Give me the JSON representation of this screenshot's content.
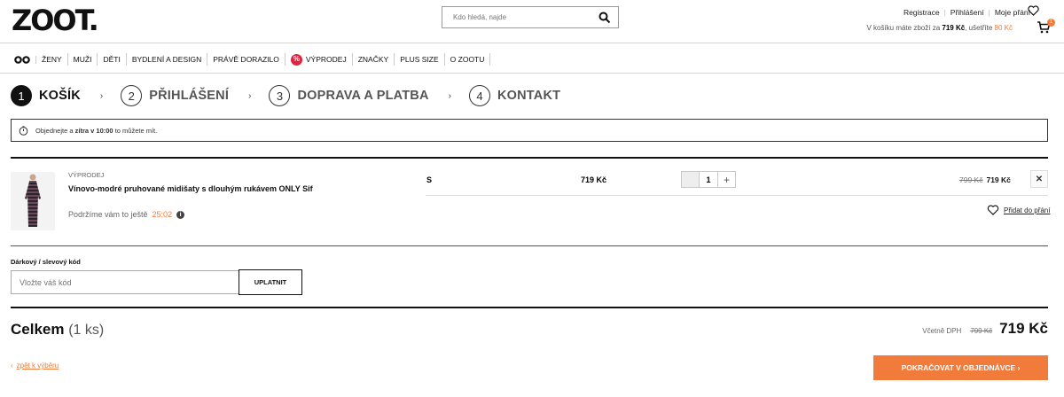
{
  "header": {
    "logo": "ZOOT.",
    "search_placeholder": "Kdo hledá, najde",
    "links": [
      "Registrace",
      "Přihlášení",
      "Moje přání"
    ],
    "cart_info_prefix": "V košíku máte zboží za",
    "cart_total": "719 Kč",
    "cart_info_mid": ", ušetříte",
    "cart_savings": "80 Kč",
    "cart_count": "1"
  },
  "nav": {
    "items": [
      "ŽENY",
      "MUŽI",
      "DĚTI",
      "BYDLENÍ A DESIGN",
      "PRÁVĚ DORAZILO",
      "VÝPRODEJ",
      "ZNAČKY",
      "PLUS SIZE",
      "O ZOOTU"
    ],
    "sale_glyph": "%"
  },
  "steps": [
    {
      "num": "1",
      "label": "KOŠÍK"
    },
    {
      "num": "2",
      "label": "PŘIHLÁŠENÍ"
    },
    {
      "num": "3",
      "label": "DOPRAVA A PLATBA"
    },
    {
      "num": "4",
      "label": "KONTAKT"
    }
  ],
  "notice": {
    "pre": "Objednejte a",
    "bold": "zítra v 10:00",
    "post": "to můžete mít."
  },
  "product": {
    "category": "VÝPRODEJ",
    "name": "Vínovo-modré pruhované midišaty s dlouhým rukávem ONLY Sif",
    "hold_text": "Podržíme vám to ještě",
    "timer": "25:02",
    "size": "S",
    "price": "719 Kč",
    "quantity": "1",
    "old_price": "799 Kč",
    "new_price": "719 Kč",
    "wishlist_label": "Přidat do přání"
  },
  "coupon": {
    "label": "Dárkový / slevový kód",
    "placeholder": "Vložte váš kód",
    "button": "UPLATNIT"
  },
  "total": {
    "label": "Celkem",
    "count": "(1 ks)",
    "vat_label": "Včetně DPH",
    "old_price": "799 Kč",
    "price": "719 Kč"
  },
  "footer": {
    "back_link": "zpět k výběru",
    "continue_button": "POKRAČOVAT V OBJEDNÁVCE ›"
  },
  "colors": {
    "accent": "#f07b3b",
    "sale_red": "#e0243e"
  }
}
